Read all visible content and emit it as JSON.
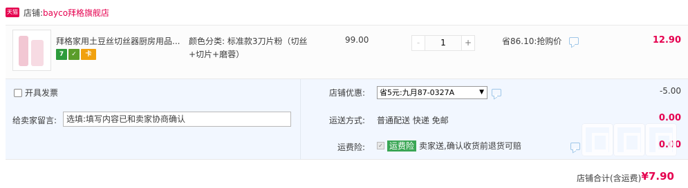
{
  "shop": {
    "badge": "天猫",
    "label": "店铺:",
    "name": "bayco拜格旗舰店"
  },
  "item": {
    "title": "拜格家用土豆丝切丝器厨房用品...",
    "sku_label": "颜色分类:",
    "sku_value": "标准款3刀片粉（切丝+切片+磨蓉）",
    "unit_price": "99.00",
    "quantity": "1",
    "qty_minus": "-",
    "qty_plus": "+",
    "save_text": "省86.10:抢购价",
    "total": "12.90",
    "badges": [
      "7",
      "✓",
      "卡"
    ]
  },
  "invoice": {
    "label": "开具发票"
  },
  "message": {
    "label": "给卖家留言:",
    "placeholder": "选填:填写内容已和卖家协商确认"
  },
  "coupon": {
    "label": "店铺优惠:",
    "selected": "省5元:九月87-0327A",
    "amount": "-5.00"
  },
  "shipping": {
    "label": "运送方式:",
    "value": "普通配送 快递 免邮",
    "amount": "0.00"
  },
  "insurance": {
    "label": "运费险:",
    "tag": "运费险",
    "desc": "卖家送,确认收货前退货可赔",
    "amount": "0.00"
  },
  "total": {
    "label": "店铺合计(含运费)",
    "value": "¥7.90"
  },
  "watermark": {
    "text": "值 值 值",
    "sub": "www.zhidechi.com"
  },
  "colors": {
    "accent": "#e5004f",
    "panel": "#f2f7ff",
    "green": "#3aa655"
  }
}
